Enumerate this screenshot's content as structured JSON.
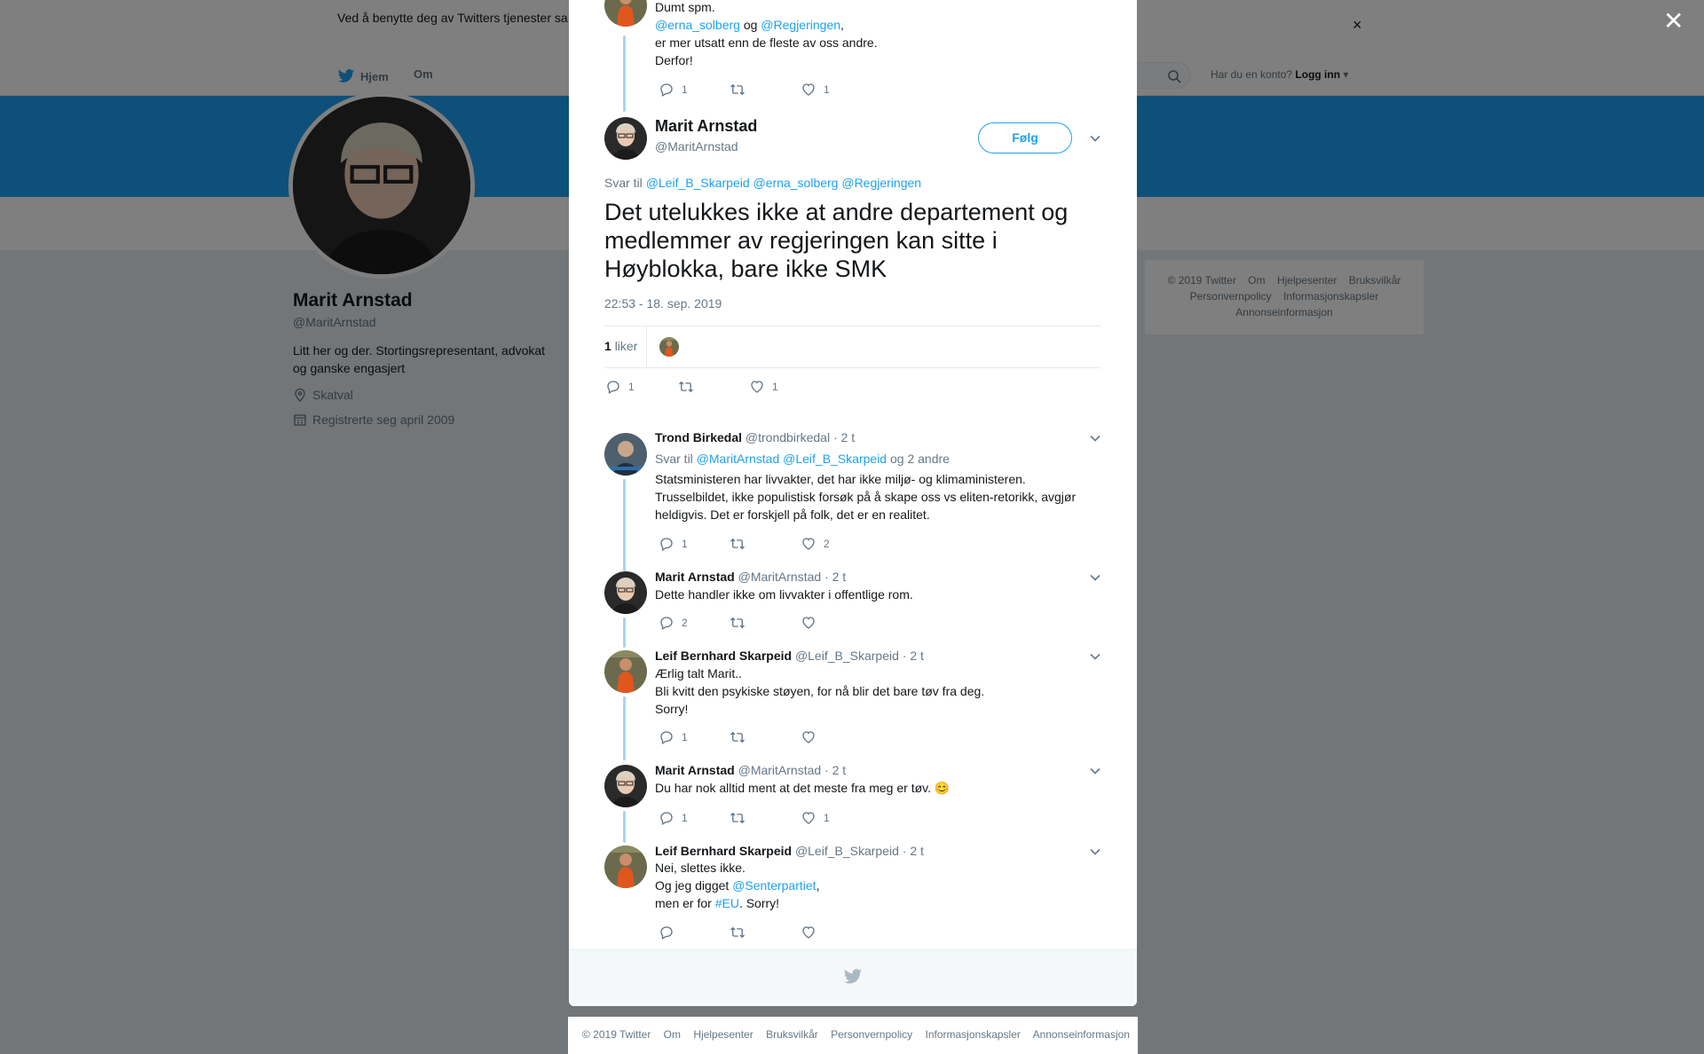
{
  "cookie": {
    "text": "Ved å benytte deg av Twitters tjenester sa… informasjonskapsler til bl.a. analyser, personalisering og annonser."
  },
  "nav": {
    "home_label": "Hjem",
    "about_label": "Om",
    "login_prompt": "Har du en konto?",
    "login_label": "Logg inn"
  },
  "profile": {
    "name": "Marit Arnstad",
    "handle": "@MaritArnstad",
    "bio": "Litt her og der. Stortingsrepresentant, advokat og ganske engasjert",
    "location": "Skatval",
    "joined": "Registrerte seg april 2009"
  },
  "side_footer": {
    "items": [
      "© 2019 Twitter",
      "Om",
      "Hjelpesenter",
      "Bruksvilkår",
      "Personvernpolicy",
      "Informasjonskapsler",
      "Annonseinformasjon"
    ]
  },
  "prev_tweet": {
    "line1": "Dumt spm.",
    "mention1": "@erna_solberg",
    "og": "og",
    "mention2": "@Regjeringen",
    "comma": ",",
    "line3": "er mer utsatt enn de fleste av oss andre.",
    "line4": "Derfor!",
    "replies": "1",
    "likes": "1"
  },
  "main_tweet": {
    "name": "Marit Arnstad",
    "handle": "@MaritArnstad",
    "follow_label": "Følg",
    "reply_to_prefix": "Svar til",
    "reply_to_mentions": "@Leif_B_Skarpeid @erna_solberg @Regjeringen",
    "text": "Det utelukkes ikke at andre departement og medlemmer av regjeringen kan sitte i Høyblokka, bare ikke SMK",
    "timestamp": "22:53 - 18. sep. 2019",
    "like_count": "1",
    "like_word": "liker",
    "replies": "1",
    "likes": "1"
  },
  "replies": [
    {
      "name": "Trond Birkedal",
      "handle": "@trondbirkedal",
      "time": "· 2 t",
      "reply_prefix": "Svar til",
      "reply_mentions": "@MaritArnstad @Leif_B_Skarpeid",
      "reply_suffix": "og 2 andre",
      "text": "Statsministeren har livvakter, det har ikke miljø- og klimaministeren. Trusselbildet, ikke populistisk forsøk på å skape oss vs eliten-retorikk, avgjør heldigvis. Det er forskjell på folk, det er en realitet.",
      "replies": "1",
      "likes": "2"
    },
    {
      "name": "Marit Arnstad",
      "handle": "@MaritArnstad",
      "time": "· 2 t",
      "text": "Dette handler ikke om livvakter i offentlige rom.",
      "replies": "2",
      "likes": ""
    },
    {
      "name": "Leif Bernhard Skarpeid",
      "handle": "@Leif_B_Skarpeid",
      "time": "· 2 t",
      "line1": "Ærlig talt Marit..",
      "line2": "Bli kvitt den psykiske støyen, for nå blir det bare tøv fra deg.",
      "line3": "Sorry!",
      "replies": "1",
      "likes": ""
    },
    {
      "name": "Marit Arnstad",
      "handle": "@MaritArnstad",
      "time": "· 2 t",
      "text": "Du har nok alltid ment at det meste fra meg er tøv.",
      "emoji": "😊",
      "replies": "1",
      "likes": "1"
    },
    {
      "name": "Leif Bernhard Skarpeid",
      "handle": "@Leif_B_Skarpeid",
      "time": "· 2 t",
      "line1": "Nei, slettes ikke.",
      "line2_prefix": "Og jeg digget",
      "line2_mention": "@Senterpartiet",
      "line2_suffix": ",",
      "line3_prefix": "men er for",
      "line3_hashtag": "#EU",
      "line3_suffix": ". Sorry!",
      "replies": "",
      "likes": ""
    }
  ],
  "bottom_footer": {
    "items": [
      "© 2019 Twitter",
      "Om",
      "Hjelpesenter",
      "Bruksvilkår",
      "Personvernpolicy",
      "Informasjonskapsler",
      "Annonseinformasjon"
    ]
  },
  "colors": {
    "brand_blue": "#1da1f2",
    "thread_line": "#a8d4f3",
    "muted": "#657786",
    "background": "#e6ecf0"
  }
}
